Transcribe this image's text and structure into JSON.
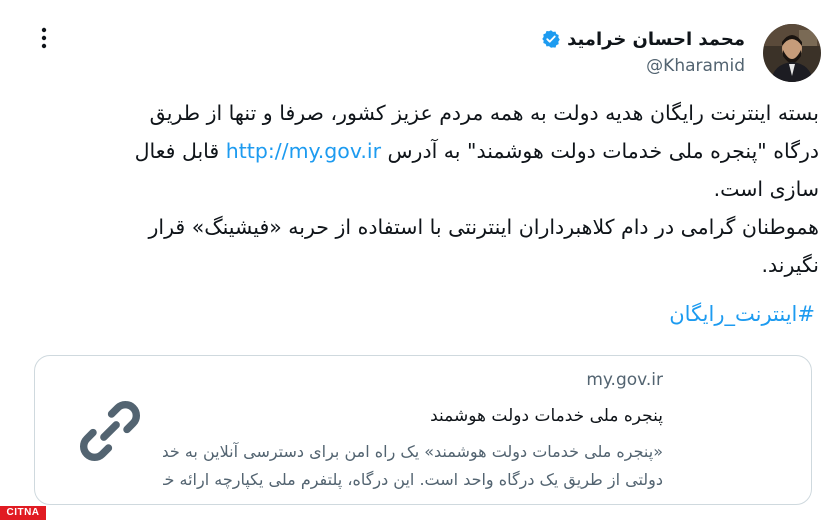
{
  "author": {
    "name": "محمد احسان خرامید",
    "handle": "@Kharamid",
    "verified_color": "#1d9bf0"
  },
  "tweet": {
    "line1": "بسته اینترنت رایگان هدیه دولت به همه مردم عزیز کشور، صرفا و تنها از طریق",
    "line2_part1": "درگاه \"پنجره ملی خدمات دولت هوشمند\" به آدرس",
    "link": "http://my.gov.ir",
    "line2_part2": "قابل فعال",
    "line3": "سازی است.",
    "line4": "هموطنان گرامی در دام کلاهبرداران اینترنتی با استفاده از حربه «فیشینگ» قرار",
    "line5": "نگیرند.",
    "hashtag": "#اینترنت_رایگان"
  },
  "card": {
    "domain": "my.gov.ir",
    "title": "پنجره ملی خدمات دولت هوشمند",
    "desc_line1": "«پنجره ملی خدمات دولت هوشمند» یک راه امن برای دسترسی آنلاین به خدمات",
    "desc_line2": "دولتی از طریق یک درگاه واحد است. این درگاه، پلتفرم ملی یکپارچه ارائه خدمات…",
    "icon": "link-icon"
  },
  "watermark": {
    "text": "CITNA",
    "color": "#e11b22"
  },
  "colors": {
    "accent": "#1d9bf0",
    "text": "#0f1419",
    "secondary": "#536471",
    "border": "#cfd9de"
  }
}
